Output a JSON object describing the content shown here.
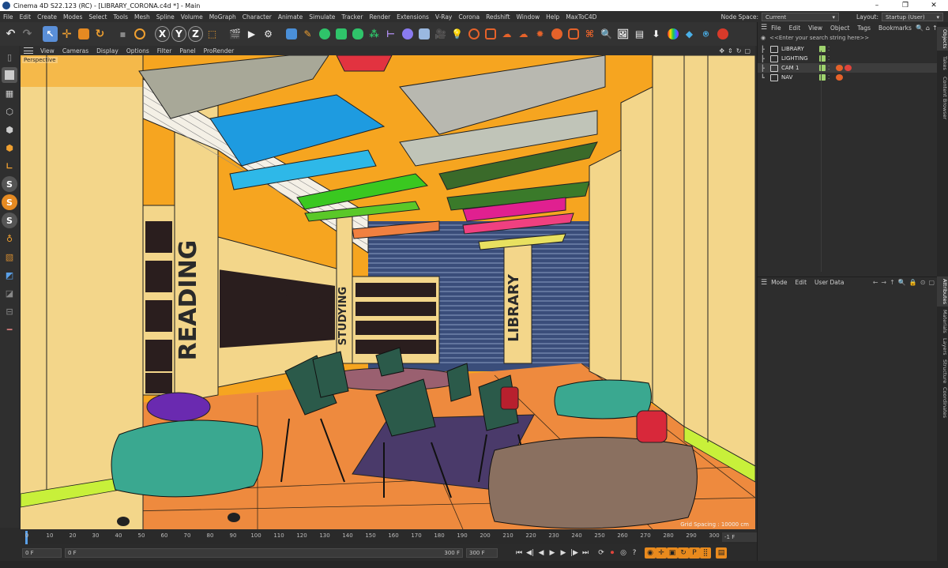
{
  "window": {
    "title": "Cinema 4D S22.123 (RC) - [LIBRARY_CORONA.c4d *] - Main",
    "controls": [
      "–",
      "❐",
      "✕"
    ]
  },
  "menubar": {
    "items": [
      "File",
      "Edit",
      "Create",
      "Modes",
      "Select",
      "Tools",
      "Mesh",
      "Spline",
      "Volume",
      "MoGraph",
      "Character",
      "Animate",
      "Simulate",
      "Tracker",
      "Render",
      "Extensions",
      "V-Ray",
      "Corona",
      "Redshift",
      "Window",
      "Help",
      "MaxToC4D"
    ],
    "node_space_label": "Node Space:",
    "node_space_value": "Current (Standard/Physical)",
    "layout_label": "Layout:",
    "layout_value": "Startup (User)"
  },
  "viewport": {
    "menu": [
      "View",
      "Cameras",
      "Display",
      "Options",
      "Filter",
      "Panel",
      "ProRender"
    ],
    "camera_label": "Perspective",
    "grid_spacing": "Grid Spacing : 10000 cm",
    "scene_text": {
      "reading": "READING",
      "studying": "STUDYING",
      "library": "LIBRARY"
    }
  },
  "timeline": {
    "ticks": [
      "0",
      "10",
      "20",
      "30",
      "40",
      "50",
      "60",
      "70",
      "80",
      "90",
      "100",
      "110",
      "120",
      "130",
      "140",
      "150",
      "160",
      "170",
      "180",
      "190",
      "200",
      "210",
      "220",
      "230",
      "240",
      "250",
      "260",
      "270",
      "280",
      "290",
      "300"
    ],
    "current_frame_box": "-1 F"
  },
  "transport": {
    "start": "0 F",
    "current": "0 F",
    "end_min": "300 F",
    "end_max": "300 F"
  },
  "objects_panel": {
    "menu": [
      "File",
      "Edit",
      "View",
      "Object",
      "Tags",
      "Bookmarks"
    ],
    "search_placeholder": "<<Enter your search string here>>",
    "objects": [
      {
        "name": "LIBRARY",
        "selected": false
      },
      {
        "name": "LIGHTING",
        "selected": false
      },
      {
        "name": "CAM 1",
        "selected": true
      },
      {
        "name": "NAV",
        "selected": false
      }
    ]
  },
  "attributes_panel": {
    "menu": [
      "Mode",
      "Edit",
      "User Data"
    ]
  },
  "side_tabs": [
    "Objects",
    "Takes",
    "Content Browser",
    "Attributes",
    "Materials",
    "Layers",
    "Structure",
    "Coordinates"
  ],
  "colors": {
    "accent_blue": "#5aa0e8",
    "viewport_orange": "#f6a520",
    "record_red": "#e0443c"
  }
}
